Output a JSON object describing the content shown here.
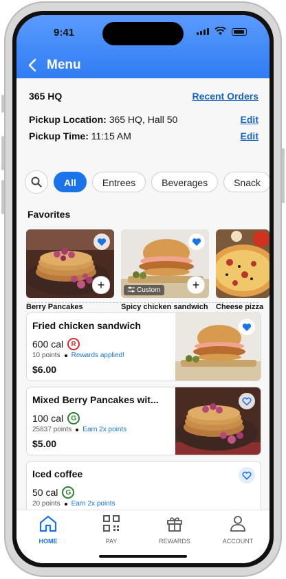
{
  "status": {
    "time": "9:41"
  },
  "header": {
    "back": "‹",
    "title": "Menu"
  },
  "location": {
    "name": "365 HQ",
    "recent_orders": "Recent Orders",
    "pickup_location_label": "Pickup Location:",
    "pickup_location_value": "365 HQ, Hall 50",
    "pickup_time_label": "Pickup Time:",
    "pickup_time_value": "11:15 AM",
    "edit": "Edit"
  },
  "filters": [
    "All",
    "Entrees",
    "Beverages",
    "Snack"
  ],
  "favorites": {
    "title": "Favorites",
    "items": [
      {
        "name": "Berry Pancakes"
      },
      {
        "name": "Spicy chicken sandwich",
        "tag": "Custom"
      },
      {
        "name": "Cheese pizza"
      }
    ]
  },
  "items": [
    {
      "name": "Fried chicken sandwich",
      "cal": "600 cal",
      "badge": "R",
      "points": "10 points",
      "note": "Rewards applied!",
      "price": "$6.00"
    },
    {
      "name": "Mixed Berry Pancakes wit...",
      "cal": "100 cal",
      "badge": "G",
      "points": "25837 points",
      "note": "Earn 2x points",
      "price": "$5.00"
    },
    {
      "name": "Iced coffee",
      "cal": "50 cal",
      "badge": "G",
      "points": "20 points",
      "note": "Earn 2x points"
    }
  ],
  "tabs": {
    "home": "HOME",
    "pay": "PAY",
    "rewards": "REWARDS",
    "account": "ACCOUNT"
  },
  "colors": {
    "accent": "#1a73e8",
    "header": "#2f7cf2",
    "red_badge": "#d32f2f",
    "green_badge": "#2e7d32"
  }
}
